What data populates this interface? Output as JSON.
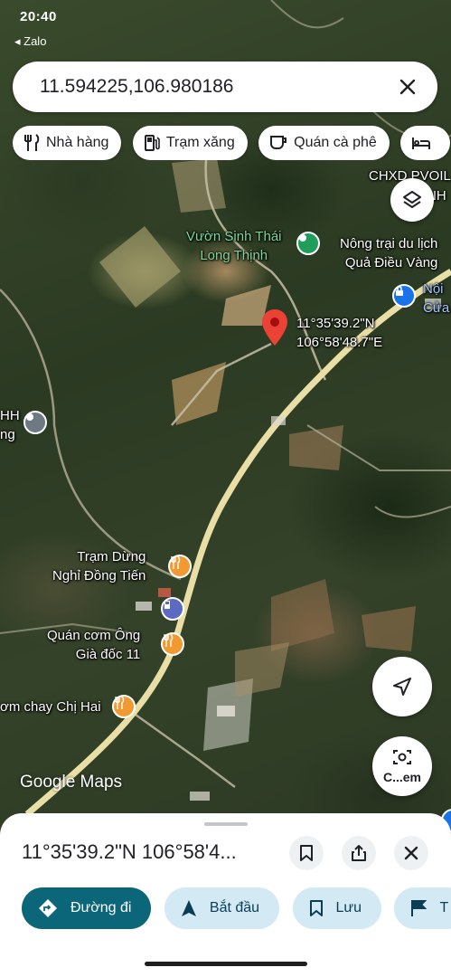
{
  "status": {
    "time": "20:40",
    "back_label": "◂ Zalo"
  },
  "search": {
    "query": "11.594225,106.980186",
    "clear_icon": "close-icon"
  },
  "chips": [
    {
      "label": "Nhà hàng",
      "icon": "restaurant-icon"
    },
    {
      "label": "Trạm xăng",
      "icon": "gas-station-icon"
    },
    {
      "label": "Quán cà phê",
      "icon": "coffee-icon"
    },
    {
      "label": "",
      "icon": "hotel-icon"
    }
  ],
  "map": {
    "labels": {
      "chxd": "CHXD PVOIL",
      "nh": "NH",
      "vuon_line1": "Vườn Sinh Thái",
      "vuon_line2": "Long Thịnh",
      "nongtrai_line1": "Nông trại du lịch",
      "nongtrai_line2": "Quả Điều Vàng",
      "noi_line1": "Nội",
      "noi_line2": "Cửa",
      "pin_lat": "11°35'39.2\"N",
      "pin_lng": "106°58'48.7\"E",
      "hh_line1": "HH",
      "hh_line2": "ng",
      "tramdung_line1": "Trạm Dừng",
      "tramdung_line2": "Nghỉ Đồng Tiến",
      "quancom_line1": "Quán cơm Ông",
      "quancom_line2": "Già đốc 11",
      "comchay": "ơm chay Chị Hai"
    },
    "attribution": "Google Maps",
    "colors": {
      "road": "#e9dfa6",
      "restaurant_poi": "#f29a32",
      "park_poi": "#1e9e5a",
      "gas_poi": "#5c6bc0",
      "pin": "#ea4335"
    }
  },
  "buttons": {
    "layers_icon": "layers-icon",
    "direction_icon": "navigation-icon",
    "camera_label": "C...em"
  },
  "sheet": {
    "title": "11°35'39.2\"N 106°58'4...",
    "actions": [
      {
        "label": "Đường đi",
        "icon": "directions-icon"
      },
      {
        "label": "Bắt đầu",
        "icon": "navigation-arrow-icon"
      },
      {
        "label": "Lưu",
        "icon": "bookmark-icon"
      },
      {
        "label": "T",
        "icon": "flag-icon"
      }
    ]
  }
}
